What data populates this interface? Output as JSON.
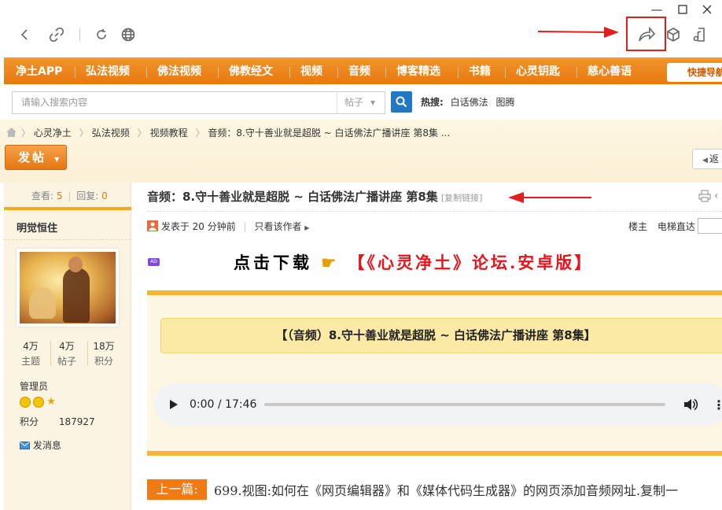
{
  "window": {
    "minimize": "—",
    "maximize": "☐",
    "close": "✕"
  },
  "nav": {
    "items": [
      "净土APP",
      "弘法视频",
      "佛法视频",
      "佛教经文",
      "视频",
      "音频",
      "博客精选",
      "书籍",
      "心灵钥匙",
      "慈心善语"
    ],
    "quick": "快捷导航"
  },
  "search": {
    "placeholder": "请输入搜索内容",
    "type": "帖子",
    "hot_label": "热搜:",
    "hot_items": [
      "白话佛法",
      "图腾"
    ]
  },
  "breadcrumb": [
    "心灵净土",
    "弘法视频",
    "视频教程",
    "音频：8.守十善业就是超脱 ~ 白话佛法广播讲座 第8集 ..."
  ],
  "post_button": "发帖",
  "back_button": "返",
  "sidebar": {
    "views_label": "查看:",
    "views": "5",
    "replies_label": "回复:",
    "replies": "0",
    "author": "明觉恒住",
    "stats": [
      {
        "value": "4万",
        "label": "主题"
      },
      {
        "value": "4万",
        "label": "帖子"
      },
      {
        "value": "18万",
        "label": "积分"
      }
    ],
    "role": "管理员",
    "points_label": "积分",
    "points": "187927",
    "message": "发消息"
  },
  "post": {
    "title": "音频：8.守十善业就是超脱 ~ 白话佛法广播讲座 第8集",
    "copy_link": "[复制链接]",
    "posted": "发表于 20 分钟前",
    "only_author": "只看该作者",
    "floor_owner": "楼主",
    "elevator": "电梯直达",
    "ad_badge": "AD",
    "download_text": "点击下载",
    "download_red": "【《心灵净土》论坛.安卓版】",
    "audio_title": "【（音频）8.守十善业就是超脱 ~ 白话佛法广播讲座 第8集】",
    "time": "0:00 / 17:46",
    "audio_progress": 0,
    "prev_label": "上一篇:",
    "prev_text": "699.视图:如何在《网页编辑器》和《媒体代码生成器》的网页添加音频网址.复制一"
  },
  "colors": {
    "accent": "#e8790f",
    "annotation": "#e02020",
    "search_button": "#2277c6"
  }
}
